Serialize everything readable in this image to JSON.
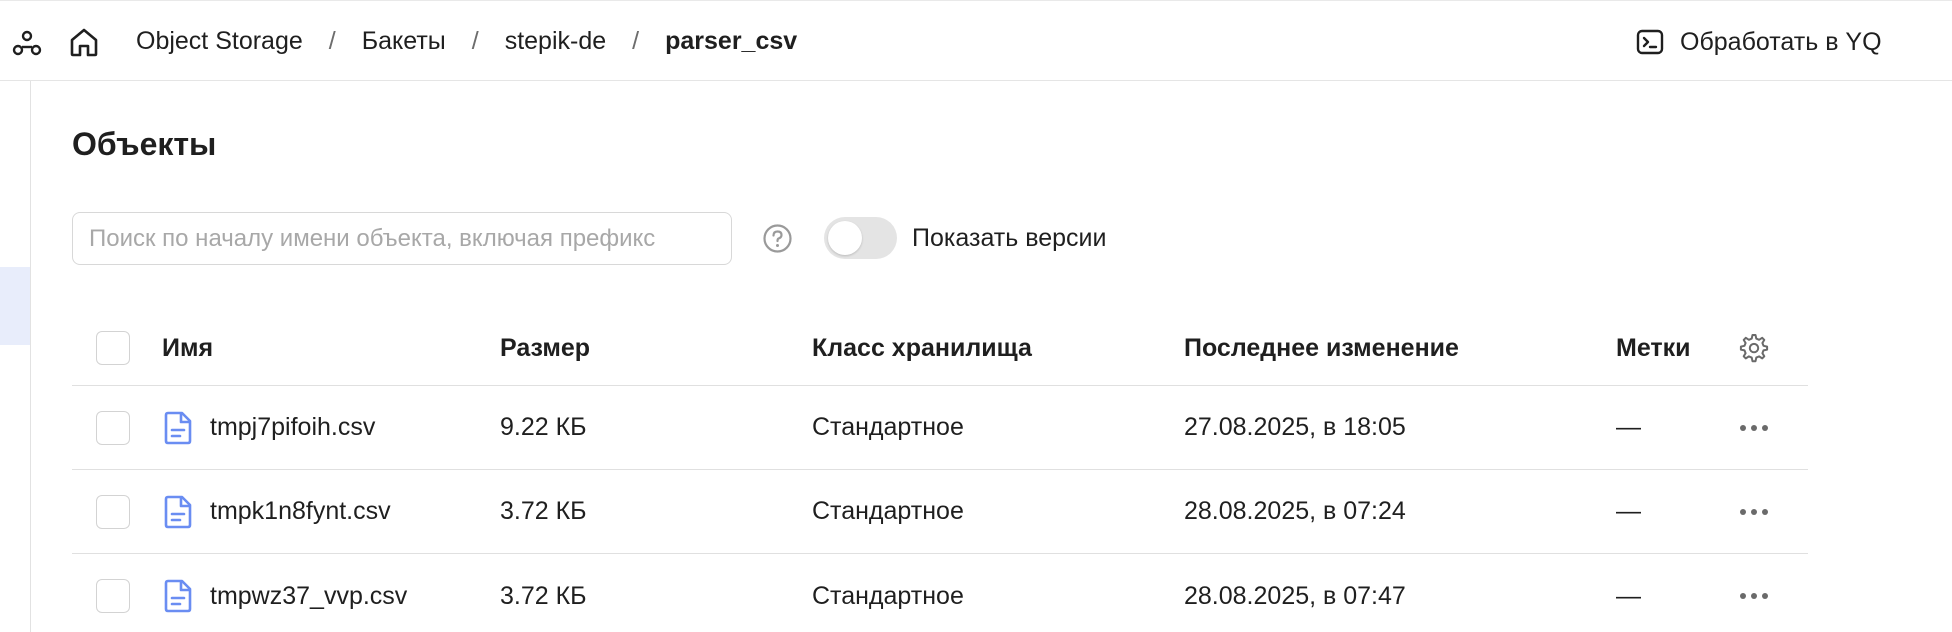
{
  "breadcrumbs": [
    "Object Storage",
    "Бакеты",
    "stepik-de",
    "parser_csv"
  ],
  "header": {
    "action_label": "Обработать в YQ"
  },
  "page": {
    "title": "Объекты"
  },
  "search": {
    "placeholder": "Поиск по началу имени объекта, включая префикс",
    "value": ""
  },
  "versions_toggle": {
    "label": "Показать версии",
    "on": false
  },
  "table": {
    "columns": {
      "name": "Имя",
      "size": "Размер",
      "storage_class": "Класс хранилища",
      "modified": "Последнее изменение",
      "tags": "Метки"
    },
    "rows": [
      {
        "name": "tmpj7pifoih.csv",
        "size": "9.22 КБ",
        "storage_class": "Стандартное",
        "modified": "27.08.2025, в 18:05",
        "tags": "—"
      },
      {
        "name": "tmpk1n8fynt.csv",
        "size": "3.72 КБ",
        "storage_class": "Стандартное",
        "modified": "28.08.2025, в 07:24",
        "tags": "—"
      },
      {
        "name": "tmpwz37_vvp.csv",
        "size": "3.72 КБ",
        "storage_class": "Стандартное",
        "modified": "28.08.2025, в 07:47",
        "tags": "—"
      }
    ]
  },
  "colors": {
    "accent": "#6a8df2",
    "active_nav_bg": "#e8edfb",
    "border": "#e0e0e0"
  }
}
